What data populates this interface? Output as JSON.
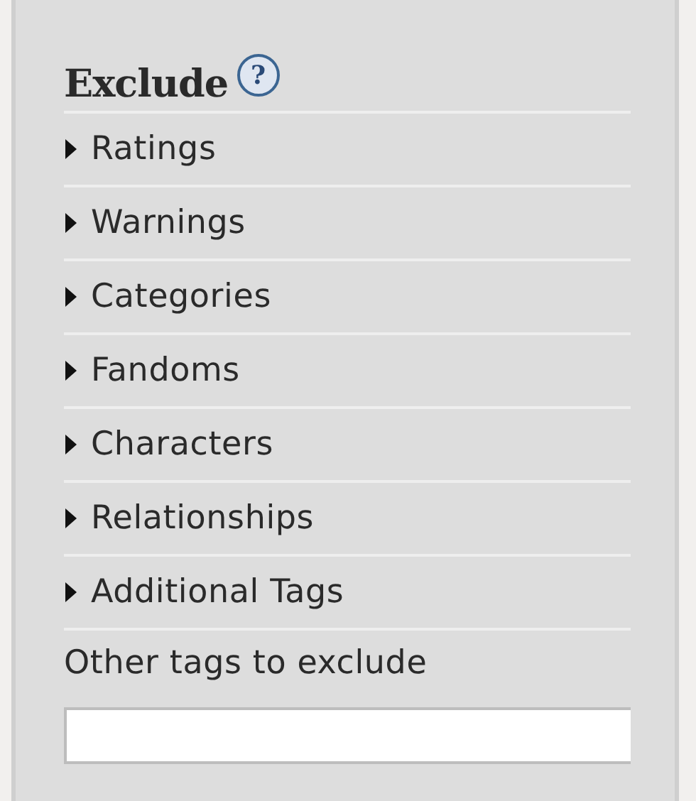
{
  "heading": {
    "title": "Exclude",
    "help": "?"
  },
  "sections": [
    {
      "label": "Ratings",
      "expanded": false
    },
    {
      "label": "Warnings",
      "expanded": false
    },
    {
      "label": "Categories",
      "expanded": false
    },
    {
      "label": "Fandoms",
      "expanded": false
    },
    {
      "label": "Characters",
      "expanded": false
    },
    {
      "label": "Relationships",
      "expanded": false
    },
    {
      "label": "Additional Tags",
      "expanded": false
    }
  ],
  "other_tags": {
    "label": "Other tags to exclude"
  }
}
